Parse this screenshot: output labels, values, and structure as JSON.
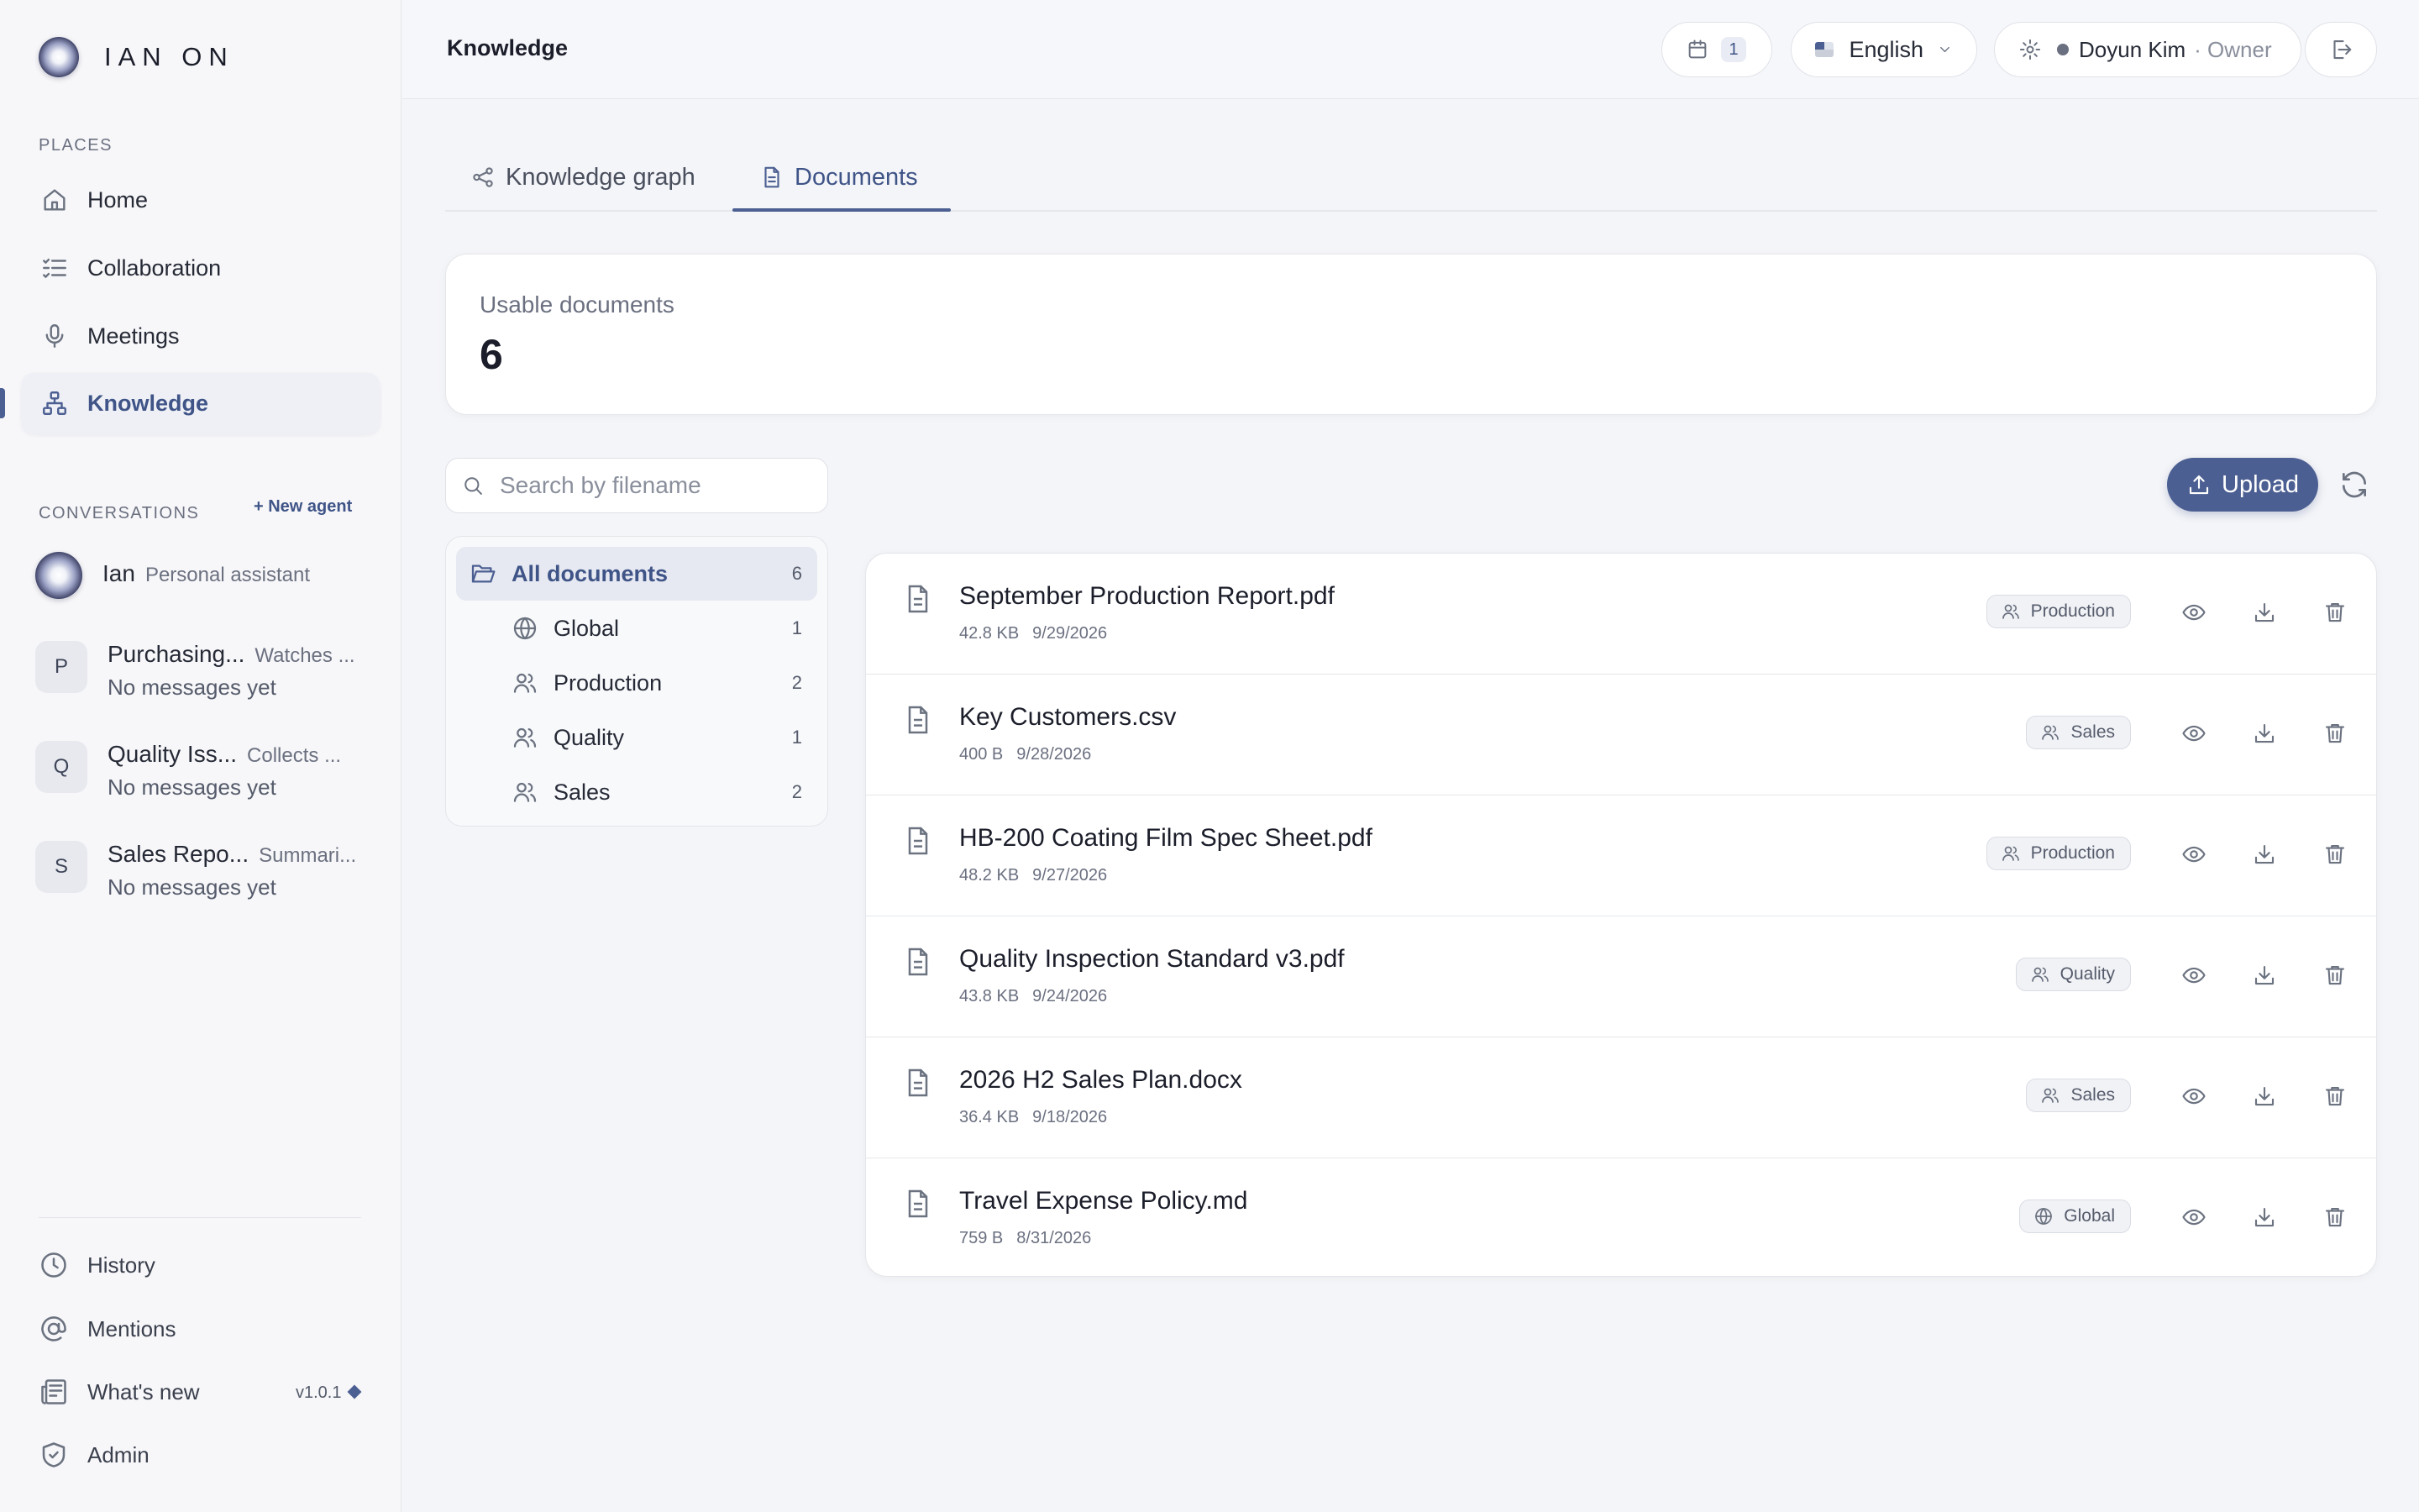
{
  "app": {
    "brand": "IAN ON"
  },
  "sidebar": {
    "places_label": "PLACES",
    "nav": [
      {
        "label": "Home",
        "icon": "home-icon"
      },
      {
        "label": "Collaboration",
        "icon": "checklist-icon"
      },
      {
        "label": "Meetings",
        "icon": "microphone-icon"
      },
      {
        "label": "Knowledge",
        "icon": "hierarchy-icon",
        "active": true
      }
    ],
    "conversations_label": "CONVERSATIONS",
    "new_agent": "+ New agent",
    "conversations": [
      {
        "name": "Ian",
        "desc": "Personal assistant",
        "avatar": ""
      },
      {
        "name": "Purchasing...",
        "desc": "Watches ...",
        "message": "No messages yet",
        "avatar": "P"
      },
      {
        "name": "Quality Iss...",
        "desc": "Collects ...",
        "message": "No messages yet",
        "avatar": "Q"
      },
      {
        "name": "Sales Repo...",
        "desc": "Summari...",
        "message": "No messages yet",
        "avatar": "S"
      }
    ],
    "bottom": [
      {
        "label": "History",
        "icon": "clock-icon"
      },
      {
        "label": "Mentions",
        "icon": "at-icon"
      },
      {
        "label": "What's new",
        "icon": "newspaper-icon"
      },
      {
        "label": "Admin",
        "icon": "shield-icon"
      }
    ],
    "version": "v1.0.1"
  },
  "header": {
    "title": "Knowledge",
    "calendar_count": "1",
    "language": "English",
    "user_name": "Doyun Kim",
    "user_role": "· Owner"
  },
  "tabs": [
    {
      "label": "Knowledge graph",
      "icon": "share-graph-icon"
    },
    {
      "label": "Documents",
      "icon": "document-icon",
      "active": true
    }
  ],
  "summary": {
    "label": "Usable documents",
    "count": "6"
  },
  "search": {
    "placeholder": "Search by filename",
    "value": ""
  },
  "upload_label": "Upload",
  "folders": [
    {
      "label": "All documents",
      "count": "6",
      "icon": "folder-open-icon"
    },
    {
      "label": "Global",
      "count": "1",
      "icon": "globe-icon"
    },
    {
      "label": "Production",
      "count": "2",
      "icon": "users-icon"
    },
    {
      "label": "Quality",
      "count": "1",
      "icon": "users-icon"
    },
    {
      "label": "Sales",
      "count": "2",
      "icon": "users-icon"
    }
  ],
  "documents": [
    {
      "name": "September Production Report.pdf",
      "size": "42.8 KB",
      "date": "9/29/2026",
      "tag": "Production",
      "tag_icon": "users-icon"
    },
    {
      "name": "Key Customers.csv",
      "size": "400 B",
      "date": "9/28/2026",
      "tag": "Sales",
      "tag_icon": "users-icon"
    },
    {
      "name": "HB-200 Coating Film Spec Sheet.pdf",
      "size": "48.2 KB",
      "date": "9/27/2026",
      "tag": "Production",
      "tag_icon": "users-icon"
    },
    {
      "name": "Quality Inspection Standard v3.pdf",
      "size": "43.8 KB",
      "date": "9/24/2026",
      "tag": "Quality",
      "tag_icon": "users-icon"
    },
    {
      "name": "2026 H2 Sales Plan.docx",
      "size": "36.4 KB",
      "date": "9/18/2026",
      "tag": "Sales",
      "tag_icon": "users-icon"
    },
    {
      "name": "Travel Expense Policy.md",
      "size": "759 B",
      "date": "8/31/2026",
      "tag": "Global",
      "tag_icon": "globe-icon"
    }
  ],
  "colors": {
    "accent": "#4c5f92",
    "background": "#f4f5f8",
    "sidebar": "#f7f7f9"
  }
}
